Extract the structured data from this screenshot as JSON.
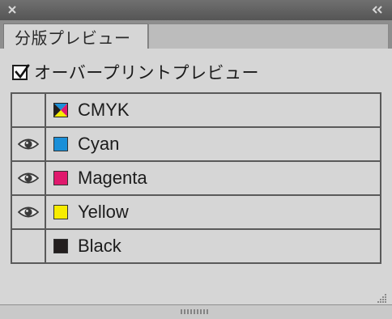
{
  "panel": {
    "tab_label": "分版プレビュー",
    "icons": {
      "close": "close-icon",
      "collapse": "double-chevron-left-icon"
    }
  },
  "overprint": {
    "label": "オーバープリントプレビュー",
    "checked": true
  },
  "separations": [
    {
      "name": "CMYK",
      "visible": false,
      "kind": "composite",
      "color": ""
    },
    {
      "name": "Cyan",
      "visible": true,
      "kind": "ink",
      "color": "#1a8fd8"
    },
    {
      "name": "Magenta",
      "visible": true,
      "kind": "ink",
      "color": "#e0196d"
    },
    {
      "name": "Yellow",
      "visible": true,
      "kind": "ink",
      "color": "#f7ec00"
    },
    {
      "name": "Black",
      "visible": false,
      "kind": "ink",
      "color": "#231e1e"
    }
  ]
}
